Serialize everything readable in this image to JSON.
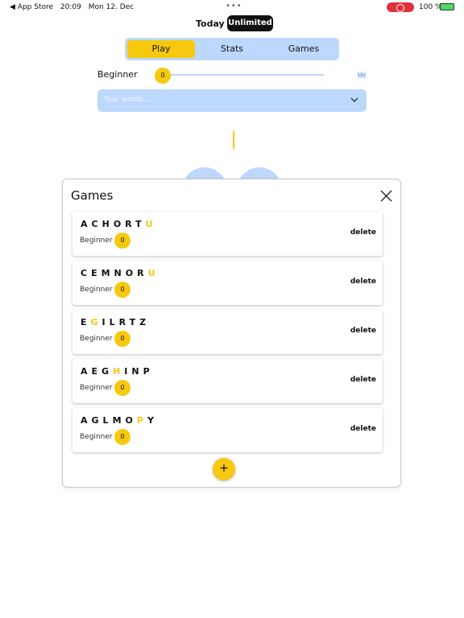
{
  "status_bar": {
    "back_app": "◀ App Store",
    "time": "20:09",
    "date": "Mon 12. Dec",
    "battery": "100 %"
  },
  "mode": {
    "today": "Today",
    "unlimited": "Unlimited"
  },
  "tabs": [
    {
      "label": "Play",
      "active": true
    },
    {
      "label": "Stats",
      "active": false
    },
    {
      "label": "Games",
      "active": false
    }
  ],
  "level": {
    "label": "Beginner",
    "value": "0"
  },
  "words": {
    "placeholder": "Your words..."
  },
  "modal": {
    "title": "Games",
    "delete_label": "delete",
    "add_label": "+",
    "games": [
      {
        "letters": [
          "A",
          "C",
          "H",
          "O",
          "R",
          "T",
          "U"
        ],
        "highlight": 6,
        "level": "Beginner",
        "score": "0"
      },
      {
        "letters": [
          "C",
          "E",
          "M",
          "N",
          "O",
          "R",
          "U"
        ],
        "highlight": 6,
        "level": "Beginner",
        "score": "0"
      },
      {
        "letters": [
          "E",
          "G",
          "I",
          "L",
          "R",
          "T",
          "Z"
        ],
        "highlight": 1,
        "level": "Beginner",
        "score": "0"
      },
      {
        "letters": [
          "A",
          "E",
          "G",
          "H",
          "I",
          "N",
          "P"
        ],
        "highlight": 3,
        "level": "Beginner",
        "score": "0"
      },
      {
        "letters": [
          "A",
          "G",
          "L",
          "M",
          "O",
          "P",
          "Y"
        ],
        "highlight": 5,
        "level": "Beginner",
        "score": "0"
      }
    ]
  },
  "colors": {
    "accent": "#f6c90e",
    "panel": "#bcd8ff",
    "dark": "#111111"
  }
}
